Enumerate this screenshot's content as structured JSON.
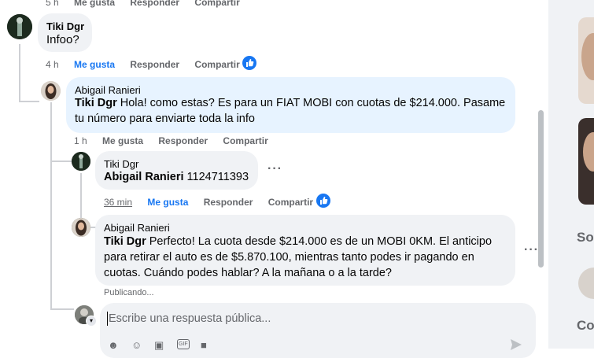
{
  "top_partial": {
    "time": "5 h",
    "like": "Me gusta",
    "reply": "Responder",
    "share": "Compartir"
  },
  "comments": [
    {
      "author": "Tiki Dgr",
      "text": "Infoo?",
      "time": "4 h",
      "like": "Me gusta",
      "reply": "Responder",
      "share": "Compartir"
    },
    {
      "author": "Abigail Ranieri",
      "mention": "Tiki Dgr",
      "text": " Hola! como estas? Es para un FIAT MOBI con cuotas de $214.000. Pasame tu número para enviarte toda la info",
      "time": "1 h",
      "like": "Me gusta",
      "reply": "Responder",
      "share": "Compartir"
    },
    {
      "author": "Tiki Dgr",
      "mention": "Abigail Ranieri",
      "text": " 1124711393",
      "time": "36 min",
      "like": "Me gusta",
      "reply": "Responder",
      "share": "Compartir",
      "more": "···"
    },
    {
      "author": "Abigail Ranieri",
      "mention": "Tiki Dgr",
      "text": " Perfecto! La cuota desde $214.000 es de un MOBI 0KM. El anticipo para retirar el auto es de $5.870.100, mientras tanto podes ir pagando en cuotas. Cuándo podes hablar? A la mañana o a la tarde?",
      "status": "Publicando...",
      "more": "···"
    }
  ],
  "reply_box": {
    "placeholder": "Escribe una respuesta pública..."
  },
  "sidebar": {
    "so": "So",
    "co": "Co"
  },
  "icons": [
    "like-icon",
    "avatar-icon",
    "sticker-icon",
    "emoji-icon",
    "camera-icon",
    "gif-icon",
    "stickers-icon",
    "send-icon"
  ],
  "colors": {
    "accent": "#1877f2",
    "bubble": "#f0f2f5",
    "bubble_highlight": "#e7f3ff"
  }
}
